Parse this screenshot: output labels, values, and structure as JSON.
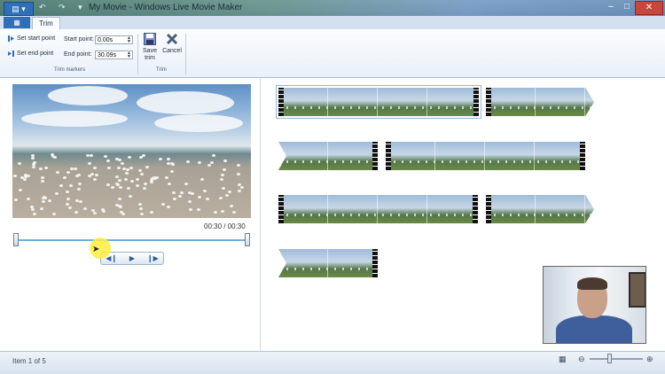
{
  "window": {
    "title": "My Movie - Windows Live Movie Maker",
    "app_menu": "▤ ▾",
    "quick_access": "↶ ↷ ▾",
    "minimize": "–",
    "maximize": "□",
    "close": "✕"
  },
  "tabs": {
    "active": "Trim"
  },
  "ribbon": {
    "set_start_point": "Set start point",
    "set_end_point": "Set end point",
    "start_point_label": "Start point:",
    "start_point_value": "0.00s",
    "end_point_label": "End point:",
    "end_point_value": "30.09s",
    "save_trim": "Save trim",
    "cancel": "Cancel",
    "group_trim_markers": "Trim markers",
    "group_trim": "Trim"
  },
  "preview": {
    "timecode": "00:30 / 00:30",
    "trim_position": 1.0
  },
  "storyboard": {
    "clip_count": 6,
    "selected_index": 0
  },
  "status": {
    "item_text": "Item 1 of 5",
    "zoom_out": "⊖",
    "zoom_in": "⊕",
    "zoom_level": 0.37
  },
  "colors": {
    "accent": "#2f6fb8",
    "close_red": "#c9463d",
    "slider": "#6fb0d8"
  }
}
